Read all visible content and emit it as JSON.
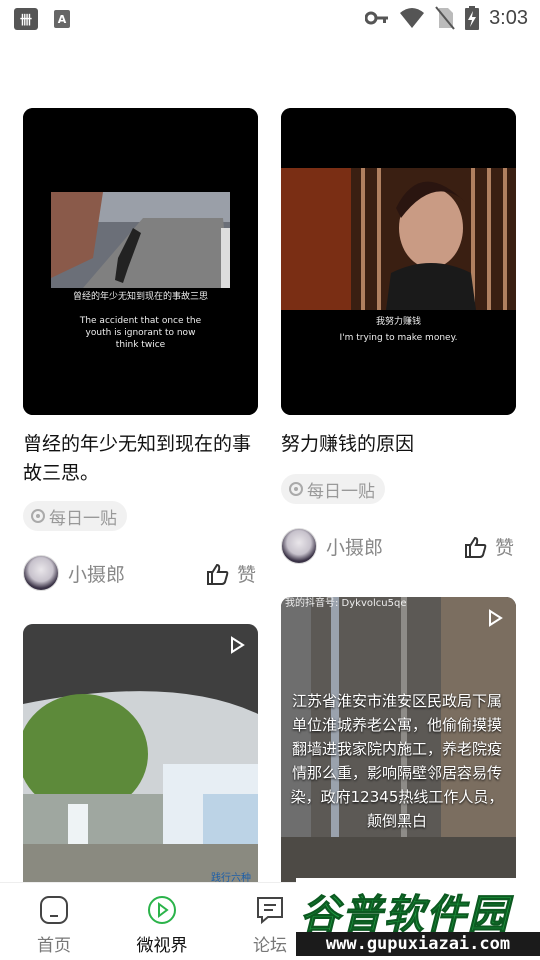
{
  "status_bar": {
    "left_icons": [
      "app-icon",
      "a-icon"
    ],
    "app_label": "卌",
    "a_label": "A",
    "right_icons": [
      "key-icon",
      "wifi-icon",
      "no-sim-icon",
      "battery-charging-icon"
    ],
    "time": "3:03"
  },
  "feed": {
    "cards": [
      {
        "title": "曾经的年少无知到现在的事故三思。",
        "subtitle_cn": "曾经的年少无知到现在的事故三思",
        "subtitle_en": "The accident that once the youth is ignorant to now think twice",
        "tag": "每日一贴",
        "author": "小摄郎",
        "like_label": "赞"
      },
      {
        "title": "努力赚钱的原因",
        "subtitle_cn": "我努力赚钱",
        "subtitle_en": "I'm trying to make money.",
        "tag": "每日一贴",
        "author": "小摄郎",
        "like_label": "赞"
      },
      {
        "title": "",
        "overlay_text": "",
        "video_text": "践行六种风"
      },
      {
        "title": "",
        "top_caption": "我的抖音号: Dykvolcu5qe",
        "overlay_text": "江苏省淮安市淮安区民政局下属单位淮城养老公寓，他偷偷摸摸翻墙进我家院内施工，养老院疫情那么重，影响隔壁邻居容易传染，政府12345热线工作人员，颠倒黑白"
      }
    ]
  },
  "bottom_nav": {
    "items": [
      {
        "label": "首页",
        "icon": "home-icon",
        "active": false
      },
      {
        "label": "微视界",
        "icon": "play-circle-icon",
        "active": true
      },
      {
        "label": "论坛",
        "icon": "chat-icon",
        "active": false
      }
    ],
    "active_color": "#2bb34a"
  },
  "watermark": {
    "brand": "谷普软件园",
    "url": "www.gupuxiazai.com"
  }
}
